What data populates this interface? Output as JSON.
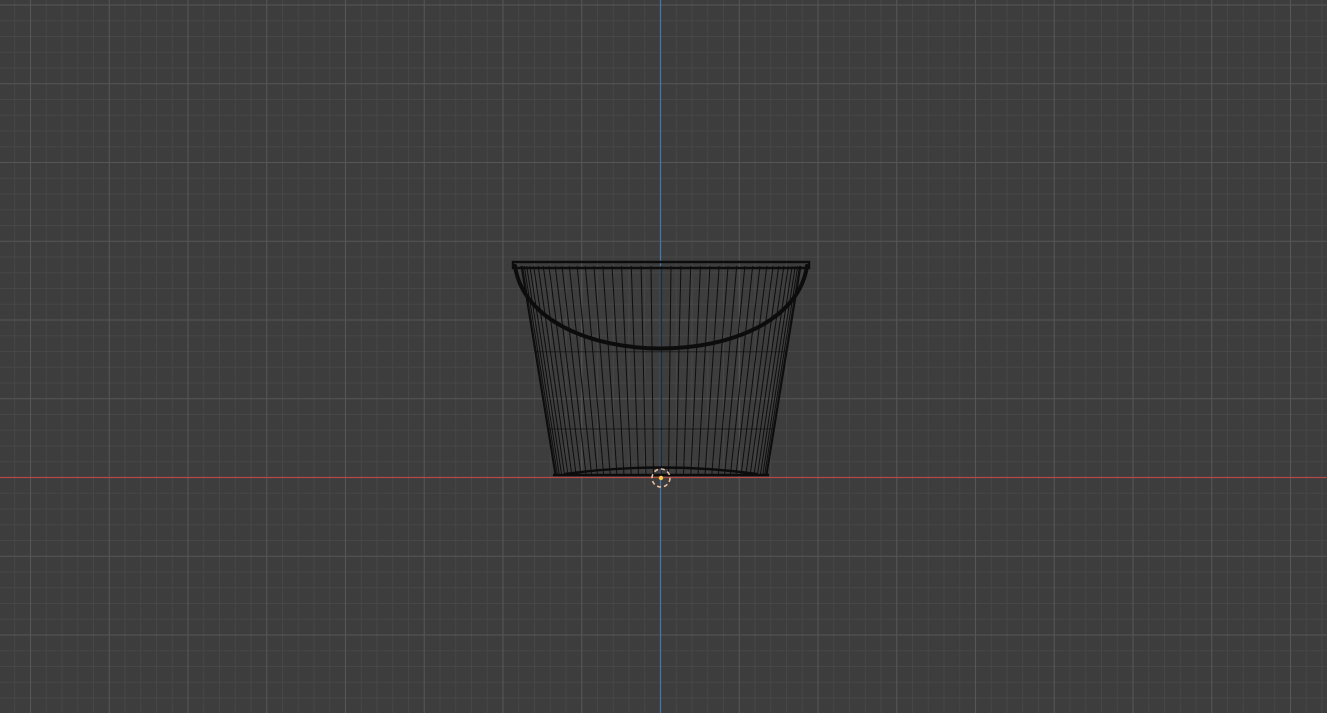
{
  "viewport": {
    "view": "front-orthographic",
    "shading": "wireframe",
    "background_color": "#3d3d3d",
    "grid": {
      "minor_color": "#474747",
      "major_color": "#565656"
    },
    "axes": {
      "x_axis_color": "#b04a4a",
      "z_axis_color": "#3f77b3"
    }
  },
  "object": {
    "name_icon": "bucket-wireframe-mesh",
    "wire_color": "#0c0c0c"
  },
  "origin": {
    "icon": "object-origin-marker",
    "ring_color": "#e8c0a0",
    "dot_color": "#ffcc44"
  }
}
